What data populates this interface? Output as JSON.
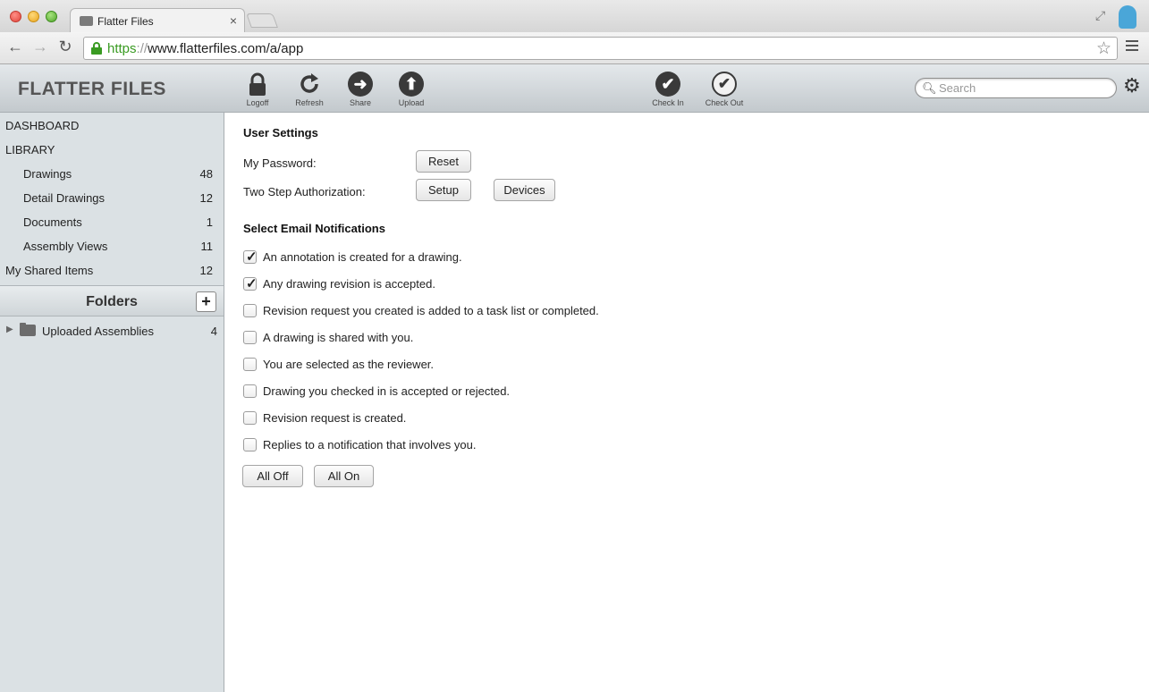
{
  "browser": {
    "tab_title": "Flatter Files",
    "tab_close": "×",
    "url_scheme": "https",
    "url_sep": "://",
    "url_rest": "www.flatterfiles.com/a/app"
  },
  "header": {
    "brand": "FLATTER FILES",
    "tools": [
      {
        "label": "Logoff",
        "icon": "lock-icon"
      },
      {
        "label": "Refresh",
        "icon": "refresh-icon"
      },
      {
        "label": "Share",
        "icon": "arrow-right-icon"
      },
      {
        "label": "Upload",
        "icon": "arrow-up-icon"
      },
      {
        "label": "Check In",
        "icon": "check-filled-icon"
      },
      {
        "label": "Check Out",
        "icon": "check-outline-icon"
      }
    ],
    "search_placeholder": "Search"
  },
  "sidebar": {
    "dashboard": "DASHBOARD",
    "library": "LIBRARY",
    "items": [
      {
        "label": "Drawings",
        "count": "48"
      },
      {
        "label": "Detail Drawings",
        "count": "12"
      },
      {
        "label": "Documents",
        "count": "1"
      },
      {
        "label": "Assembly Views",
        "count": "11"
      }
    ],
    "shared": {
      "label": "My Shared Items",
      "count": "12"
    },
    "folders_title": "Folders",
    "add_folder": "+",
    "folders": [
      {
        "name": "Uploaded Assemblies",
        "count": "4"
      }
    ]
  },
  "settings": {
    "title": "User Settings",
    "password_label": "My Password:",
    "reset_btn": "Reset",
    "twostep_label": "Two Step Authorization:",
    "setup_btn": "Setup",
    "devices_btn": "Devices",
    "notif_title": "Select Email Notifications",
    "notifications": [
      {
        "text": "An annotation is created for a drawing.",
        "checked": true
      },
      {
        "text": "Any drawing revision is accepted.",
        "checked": true
      },
      {
        "text": "Revision request you created is added to a task list or completed.",
        "checked": false
      },
      {
        "text": "A drawing is shared with you.",
        "checked": false
      },
      {
        "text": "You are selected as the reviewer.",
        "checked": false
      },
      {
        "text": "Drawing you checked in is accepted or rejected.",
        "checked": false
      },
      {
        "text": "Revision request is created.",
        "checked": false
      },
      {
        "text": "Replies to a notification that involves you.",
        "checked": false
      }
    ],
    "all_off_btn": "All Off",
    "all_on_btn": "All On"
  }
}
